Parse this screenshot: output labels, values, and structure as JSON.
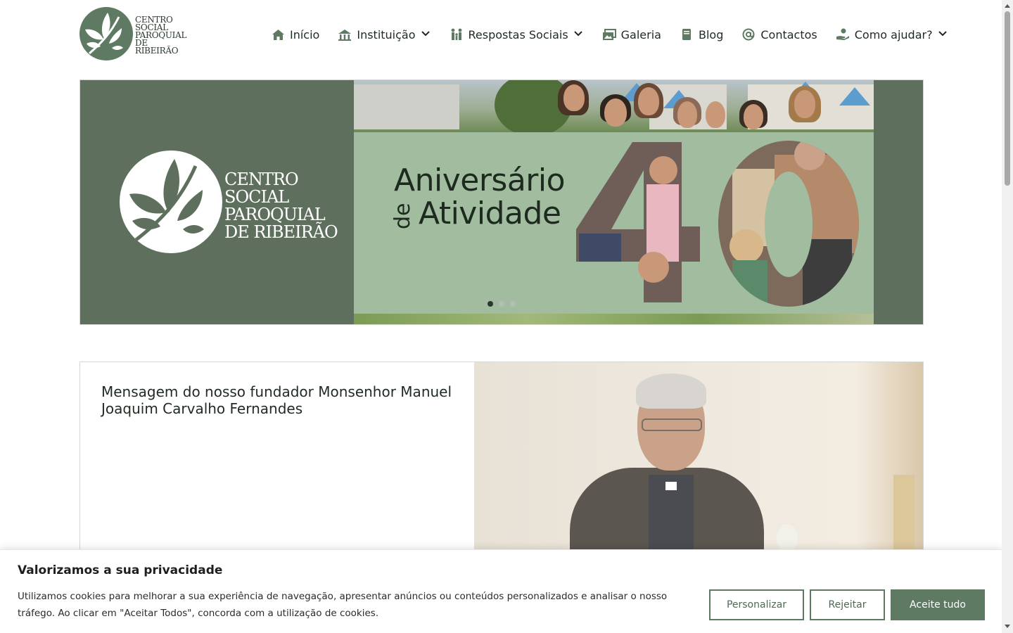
{
  "brand": {
    "name_lines": [
      "CENTRO",
      "SOCIAL",
      "PAROQUIAL",
      "DE RIBEIRÃO"
    ]
  },
  "nav": {
    "items": [
      {
        "label": "Início",
        "icon": "home-icon",
        "dropdown": false
      },
      {
        "label": "Instituição",
        "icon": "institution-icon",
        "dropdown": true
      },
      {
        "label": "Respostas Sociais",
        "icon": "people-icon",
        "dropdown": true
      },
      {
        "label": "Galeria",
        "icon": "gallery-icon",
        "dropdown": false
      },
      {
        "label": "Blog",
        "icon": "book-icon",
        "dropdown": false
      },
      {
        "label": "Contactos",
        "icon": "at-icon",
        "dropdown": false
      },
      {
        "label": "Como ajudar?",
        "icon": "helping-hand-icon",
        "dropdown": true
      }
    ]
  },
  "hero": {
    "logo_lines": [
      "CENTRO",
      "SOCIAL",
      "PAROQUIAL",
      "DE RIBEIRÃO"
    ],
    "banner_line1": "Aniversário",
    "banner_de": "de",
    "banner_line2": "Atividade",
    "banner_number": "40",
    "slides_total": 3,
    "active_slide": 1
  },
  "content": {
    "title": "Mensagem do nosso fundador Monsenhor Manuel Joaquim Carvalho Fernandes"
  },
  "cookie": {
    "title": "Valorizamos a sua privacidade",
    "text": "Utilizamos cookies para melhorar a sua experiência de navegação, apresentar anúncios ou conteúdos personalizados e analisar o nosso tráfego. Ao clicar em \"Aceitar Todos\", concorda com a utilização de cookies.",
    "customize_label": "Personalizar",
    "reject_label": "Rejeitar",
    "accept_label": "Aceite tudo"
  },
  "colors": {
    "brand_green": "#5e7a63",
    "hero_dark_green": "#5e705d",
    "hero_light_green": "#a2bca0",
    "text_dark": "#1f2a22"
  }
}
